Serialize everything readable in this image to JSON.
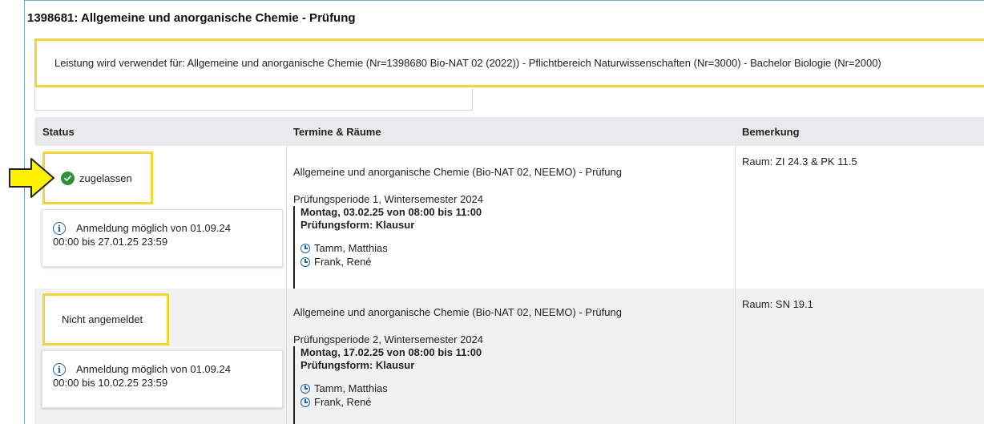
{
  "header": {
    "title": "1398681: Allgemeine und anorganische Chemie - Prüfung",
    "usage": "Leistung wird verwendet für: Allgemeine und anorganische Chemie (Nr=1398680 Bio-NAT 02 (2022)) - Pflichtbereich Naturwissenschaften (Nr=3000) - Bachelor Biologie (Nr=2000)"
  },
  "table": {
    "columns": [
      "Status",
      "Termine & Räume",
      "Bemerkung"
    ],
    "rows": [
      {
        "status": "zugelassen",
        "info": "Anmeldung möglich von 01.09.24 00:00 bis 27.01.25 23:59",
        "info_line1": "Anmeldung möglich von 01.09.24",
        "info_line2": "00:00 bis 27.01.25 23:59",
        "term_title": "Allgemeine und anorganische Chemie (Bio-NAT 02, NEEMO) - Prüfung",
        "period": "Prüfungsperiode 1, Wintersemester 2024",
        "date": "Montag, 03.02.25 von 08:00 bis 11:00",
        "form": "Prüfungsform: Klausur",
        "examiners": [
          "Tamm, Matthias",
          "Frank, René"
        ],
        "remark": "Raum: ZI 24.3 & PK 11.5"
      },
      {
        "status": "Nicht angemeldet",
        "info": "Anmeldung möglich von 01.09.24 00:00 bis 10.02.25 23:59",
        "info_line1": "Anmeldung möglich von 01.09.24",
        "info_line2": "00:00 bis 10.02.25 23:59",
        "term_title": "Allgemeine und anorganische Chemie (Bio-NAT 02, NEEMO) - Prüfung",
        "period": "Prüfungsperiode 2, Wintersemester 2024",
        "date": "Montag, 17.02.25 von 08:00 bis 11:00",
        "form": "Prüfungsform: Klausur",
        "examiners": [
          "Tamm, Matthias",
          "Frank, René"
        ],
        "remark": "Raum: SN 19.1"
      }
    ]
  },
  "colors": {
    "highlight": "#f2d637",
    "accent": "#1f5fa8",
    "success": "#2f8f3a",
    "arrow": "#fff200"
  },
  "icons": [
    "arrow-pointer-icon",
    "check-circle-icon",
    "info-icon",
    "clock-icon"
  ]
}
